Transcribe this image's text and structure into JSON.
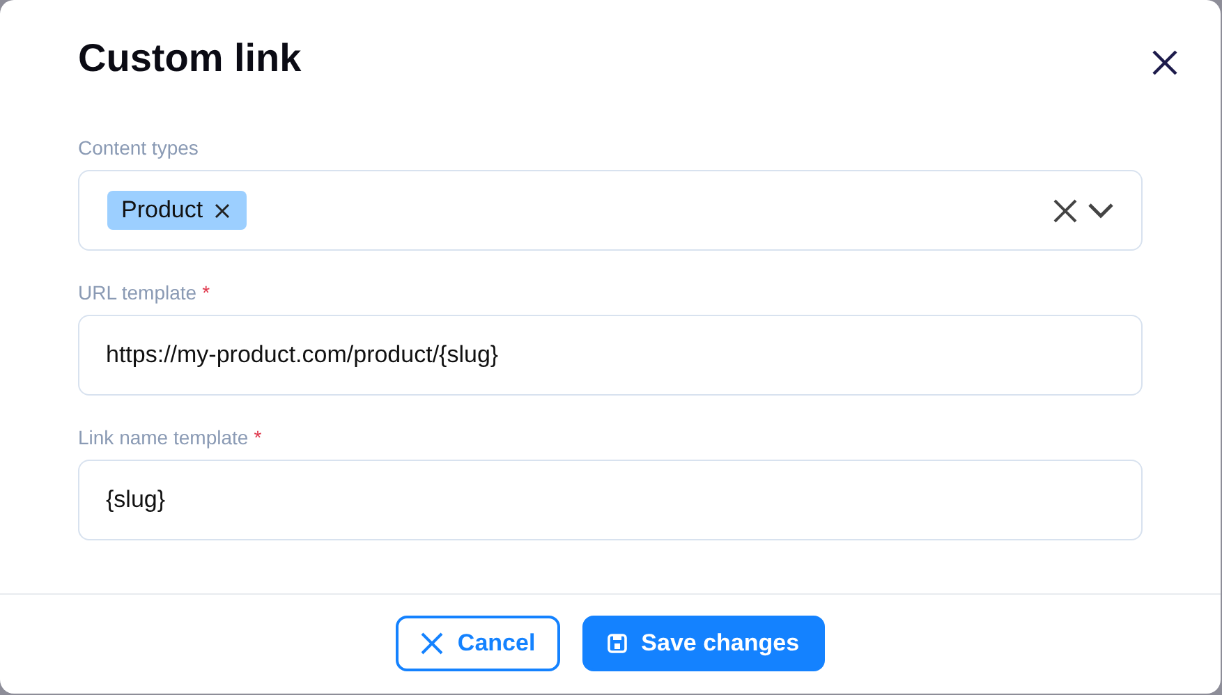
{
  "dialog": {
    "title": "Custom link"
  },
  "fields": [
    {
      "kind": "multiselect",
      "label": "Content types",
      "tags": [
        "Product"
      ]
    },
    {
      "kind": "text",
      "label": "URL template",
      "required_mark": "*",
      "value": "https://my-product.com/product/{slug}"
    },
    {
      "kind": "text",
      "label": "Link name template",
      "required_mark": "*",
      "value": "{slug}"
    }
  ],
  "buttons": [
    {
      "kind": "secondary",
      "label": "Cancel"
    },
    {
      "kind": "primary",
      "label": "Save changes"
    }
  ]
}
